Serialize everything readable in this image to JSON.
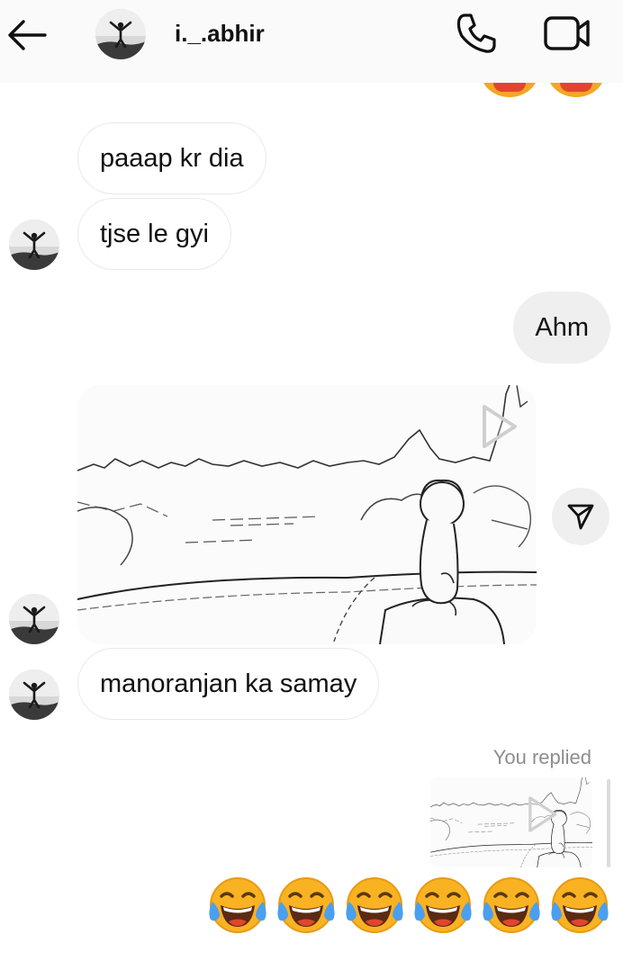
{
  "header": {
    "username": "i._.abhir"
  },
  "messages": [
    {
      "side": "in",
      "text": "paaap kr dia"
    },
    {
      "side": "in",
      "text": "tjse le gyi"
    },
    {
      "side": "out",
      "text": "Ahm"
    },
    {
      "side": "in",
      "type": "video"
    },
    {
      "side": "in",
      "text": "manoranjan ka samay"
    }
  ],
  "reply": {
    "label": "You replied",
    "reaction": "😂😂😂😂😂😂",
    "emoji_count": 6
  },
  "icons": {
    "back": "arrow-left-icon",
    "call": "phone-icon",
    "video_call": "video-camera-icon",
    "share": "paper-plane-icon",
    "play": "play-icon",
    "laugh": "face-with-tears-of-joy-icon"
  },
  "colors": {
    "header_bg": "#fafafa",
    "incoming_bubble_bg": "#ffffff",
    "outgoing_bubble_bg": "#efefef",
    "meta_text": "#8e8e8e",
    "emoji_face": "#f9b222"
  }
}
